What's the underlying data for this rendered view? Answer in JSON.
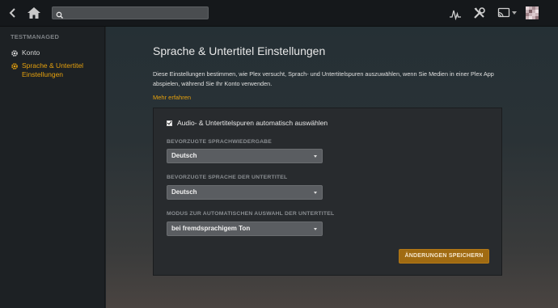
{
  "topbar": {
    "back_icon": "chevron-left-icon",
    "home_icon": "home-icon",
    "search": {
      "value": "",
      "placeholder": "",
      "icon": "search-icon"
    },
    "icons": [
      "activity-icon",
      "settings-icon",
      "cast-icon",
      "avatar"
    ]
  },
  "sidebar": {
    "heading": "TESTMANAGED",
    "items": [
      {
        "label": "Konto",
        "icon": "gear-icon",
        "active": false
      },
      {
        "label": "Sprache & Untertitel Einstellungen",
        "icon": "gear-icon",
        "active": true
      }
    ]
  },
  "main": {
    "title": "Sprache & Untertitel Einstellungen",
    "description": "Diese Einstellungen bestimmen, wie Plex versucht, Sprach- und Untertitelspuren auszuwählen, wenn Sie Medien in einer Plex App abspielen, während Sie Ihr Konto verwenden.",
    "learn_more": "Mehr erfahren",
    "panel": {
      "auto_select_label": "Audio- & Untertitelspuren automatisch auswählen",
      "auto_select_checked": true,
      "fields": [
        {
          "label": "BEVORZUGTE SPRACHWIEDERGABE",
          "value": "Deutsch"
        },
        {
          "label": "BEVORZUGTE SPRACHE DER UNTERTITEL",
          "value": "Deutsch"
        },
        {
          "label": "MODUS ZUR AUTOMATISCHEN AUSWAHL DER UNTERTITEL",
          "value": "bei fremdsprachigem Ton"
        }
      ],
      "save_label": "ÄNDERUNGEN SPEICHERN"
    }
  },
  "colors": {
    "accent": "#e5a00d",
    "button": "#a06b12"
  }
}
